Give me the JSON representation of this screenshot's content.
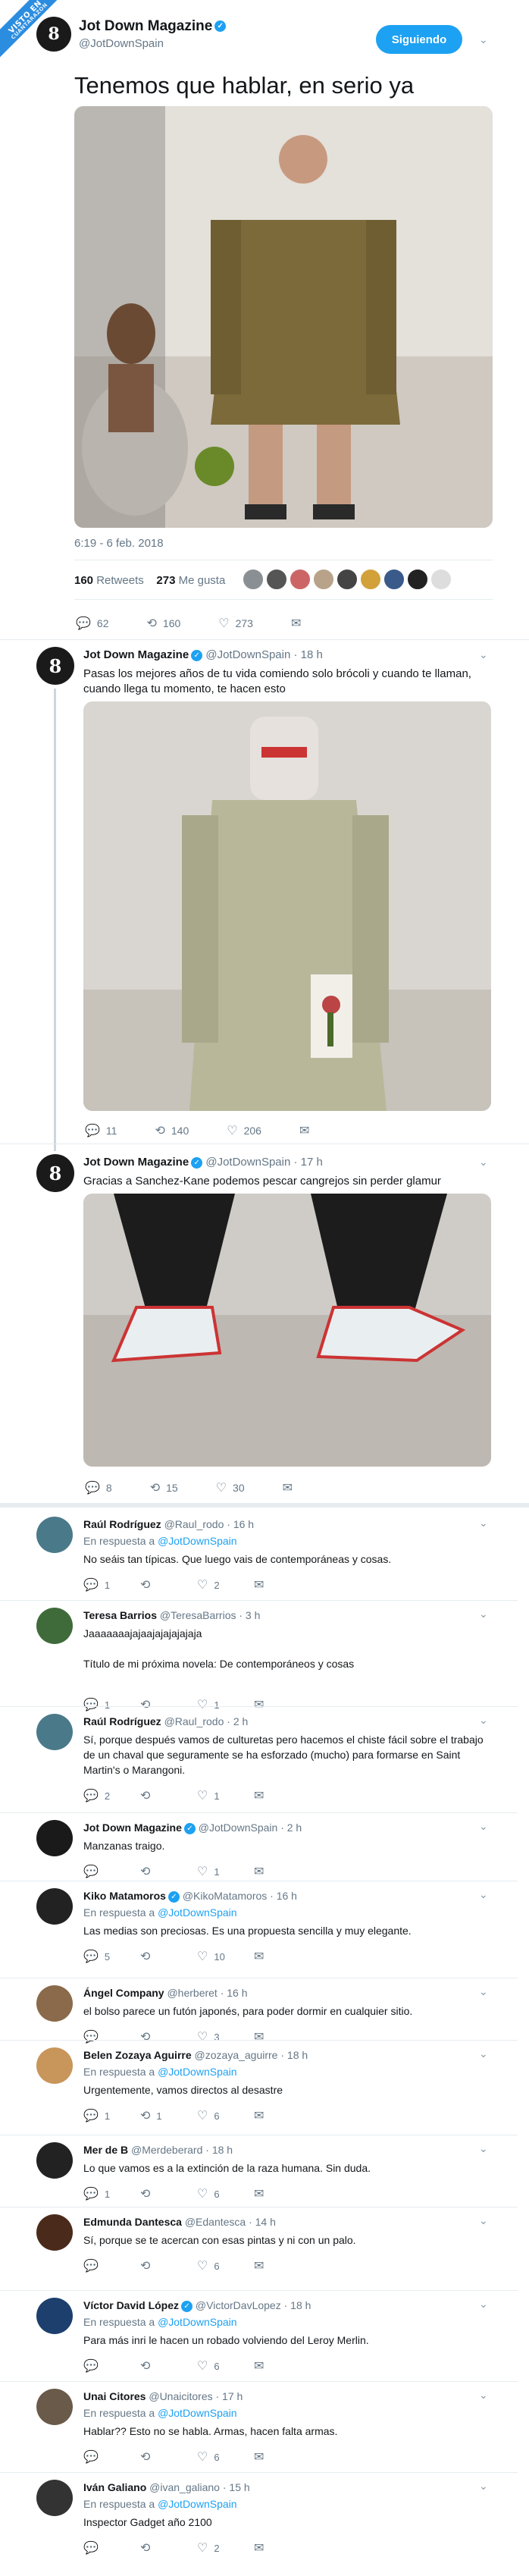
{
  "watermark": {
    "line1": "VISTO EN",
    "line2": "CUANTARAZON"
  },
  "main": {
    "display_name": "Jot Down Magazine",
    "handle": "@JotDownSpain",
    "follow_label": "Siguiendo",
    "text": "Tenemos que hablar, en serio ya",
    "timestamp": "6:19 - 6 feb. 2018",
    "retweets_count": "160",
    "retweets_label": "Retweets",
    "likes_count": "273",
    "likes_label": "Me gusta",
    "actions": {
      "replies": "62",
      "retweets": "160",
      "likes": "273"
    }
  },
  "thread": [
    {
      "display_name": "Jot Down Magazine",
      "handle": "@JotDownSpain",
      "time": "· 18 h",
      "text": "Pasas los mejores años de tu vida comiendo solo brócoli y cuando te llaman, cuando llega tu momento, te hacen esto",
      "actions": {
        "replies": "11",
        "retweets": "140",
        "likes": "206"
      }
    },
    {
      "display_name": "Jot Down Magazine",
      "handle": "@JotDownSpain",
      "time": "· 17 h",
      "text": "Gracias a Sanchez-Kane podemos pescar cangrejos sin perder glamur",
      "actions": {
        "replies": "8",
        "retweets": "15",
        "likes": "30"
      }
    }
  ],
  "replies": [
    {
      "name": "Raúl Rodríguez",
      "handle": "@Raul_rodo",
      "time": "· 16 h",
      "reply_to_prefix": "En respuesta a",
      "reply_to": "@JotDownSpain",
      "text": "No seáis tan típicas. Que luego vais de contemporáneas y cosas.",
      "replies": "1",
      "retweets": "",
      "likes": "2",
      "verified": false
    },
    {
      "name": "Teresa Barrios",
      "handle": "@TeresaBarrios",
      "time": "· 3 h",
      "reply_to_prefix": "",
      "reply_to": "",
      "text": "Jaaaaaaajajaajajajajajaja\n\nTítulo de mi próxima novela: De contemporáneos y cosas",
      "replies": "1",
      "retweets": "",
      "likes": "1",
      "verified": false
    },
    {
      "name": "Raúl Rodríguez",
      "handle": "@Raul_rodo",
      "time": "· 2 h",
      "reply_to_prefix": "",
      "reply_to": "",
      "text": "Sí, porque después vamos de culturetas pero hacemos el chiste fácil sobre el trabajo de un chaval que seguramente se ha esforzado (mucho) para formarse en Saint Martin's o Marangoni.",
      "replies": "2",
      "retweets": "",
      "likes": "1",
      "verified": false
    },
    {
      "name": "Jot Down Magazine",
      "handle": "@JotDownSpain",
      "time": "· 2 h",
      "reply_to_prefix": "",
      "reply_to": "",
      "text": "Manzanas traigo.",
      "replies": "",
      "retweets": "",
      "likes": "1",
      "verified": true
    },
    {
      "name": "Kiko Matamoros",
      "handle": "@KikoMatamoros",
      "time": "· 16 h",
      "reply_to_prefix": "En respuesta a",
      "reply_to": "@JotDownSpain",
      "text": "Las medias son preciosas. Es una propuesta sencilla y muy elegante.",
      "replies": "5",
      "retweets": "",
      "likes": "10",
      "verified": true
    },
    {
      "name": "Ángel Company",
      "handle": "@herberet",
      "time": "· 16 h",
      "reply_to_prefix": "",
      "reply_to": "",
      "text": "el bolso parece un futón japonés, para poder dormir en cualquier sitio.",
      "replies": "",
      "retweets": "",
      "likes": "3",
      "verified": false
    },
    {
      "name": "Belen Zozaya Aguirre",
      "handle": "@zozaya_aguirre",
      "time": "· 18 h",
      "reply_to_prefix": "En respuesta a",
      "reply_to": "@JotDownSpain",
      "text": "Urgentemente, vamos directos al desastre",
      "replies": "1",
      "retweets": "1",
      "likes": "6",
      "verified": false
    },
    {
      "name": "Mer de B",
      "handle": "@Merdeberard",
      "time": "· 18 h",
      "reply_to_prefix": "",
      "reply_to": "",
      "text": "Lo que vamos es a la extinción de la raza humana. Sin duda.",
      "replies": "1",
      "retweets": "",
      "likes": "6",
      "verified": false
    },
    {
      "name": "Edmunda Dantesca",
      "handle": "@Edantesca",
      "time": "· 14 h",
      "reply_to_prefix": "",
      "reply_to": "",
      "text": "Sí, porque se te acercan con esas pintas y ni con un palo.",
      "replies": "",
      "retweets": "",
      "likes": "6",
      "verified": false
    },
    {
      "name": "Víctor David López",
      "handle": "@VictorDavLopez",
      "time": "· 18 h",
      "reply_to_prefix": "En respuesta a",
      "reply_to": "@JotDownSpain",
      "text": "Para más inri le hacen un robado volviendo del Leroy Merlin.",
      "replies": "",
      "retweets": "",
      "likes": "6",
      "verified": true
    },
    {
      "name": "Unai Citores",
      "handle": "@Unaicitores",
      "time": "· 17 h",
      "reply_to_prefix": "En respuesta a",
      "reply_to": "@JotDownSpain",
      "text": "Hablar?? Esto no se habla. Armas, hacen falta armas.",
      "replies": "",
      "retweets": "",
      "likes": "6",
      "verified": false
    },
    {
      "name": "Iván Galiano",
      "handle": "@ivan_galiano",
      "time": "· 15 h",
      "reply_to_prefix": "En respuesta a",
      "reply_to": "@JotDownSpain",
      "text": "Inspector Gadget año 2100",
      "replies": "",
      "retweets": "",
      "likes": "2",
      "verified": false
    }
  ],
  "colors": {
    "accent": "#1da1f2",
    "muted": "#657786",
    "text": "#14171a",
    "separator": "#e6ecf0"
  },
  "icons": {
    "reply": "reply-icon",
    "retweet": "retweet-icon",
    "like": "heart-icon",
    "dm": "envelope-icon",
    "more": "chevron-down-icon"
  }
}
